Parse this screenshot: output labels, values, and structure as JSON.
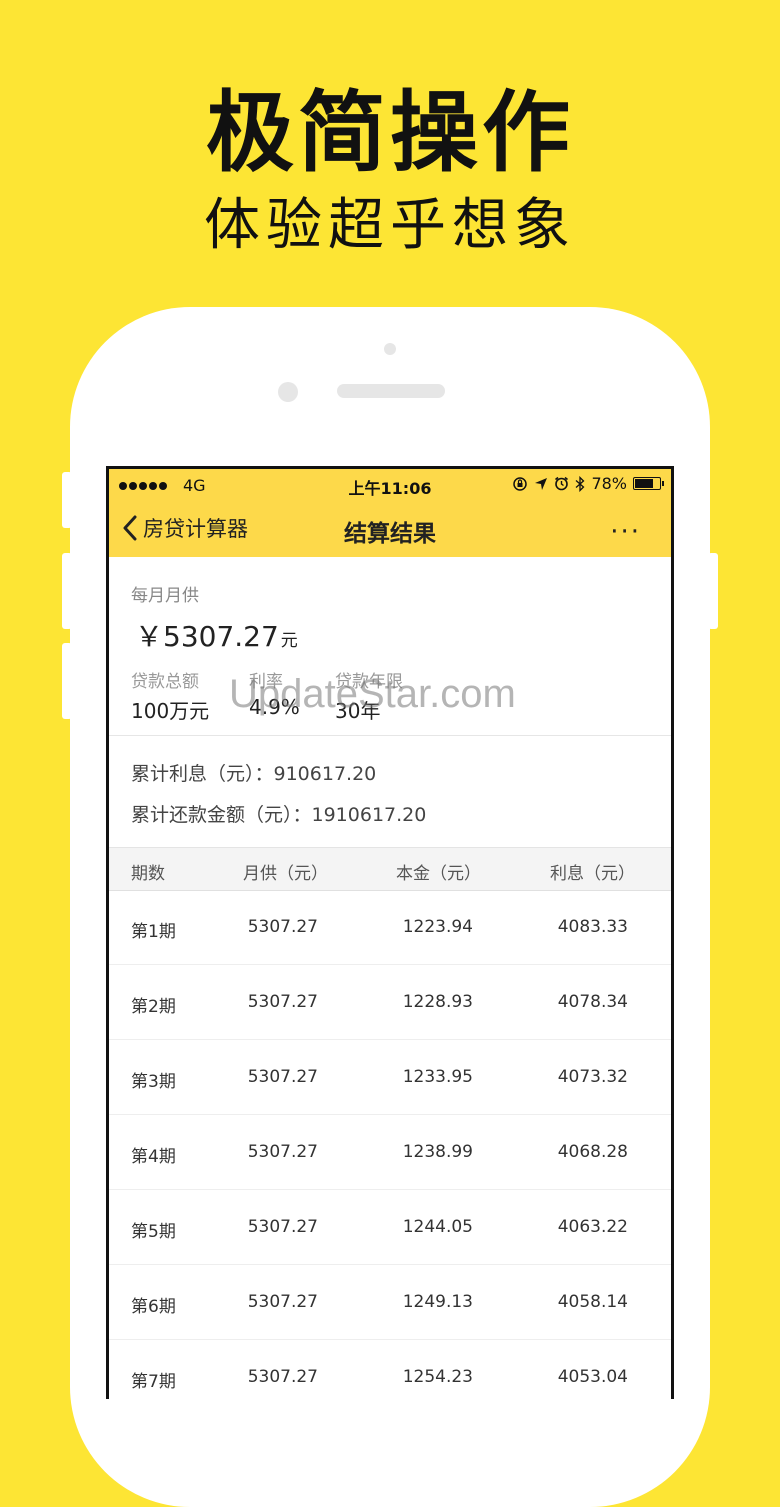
{
  "promo": {
    "headline": "极简操作",
    "subheadline": "体验超乎想象"
  },
  "statusbar": {
    "carrier": "4G",
    "time": "上午11:06",
    "battery": "78%",
    "battery_level": 0.78
  },
  "nav": {
    "back_label": "房贷计算器",
    "title": "结算结果",
    "more_label": "···"
  },
  "summary": {
    "monthly_label": "每月月供",
    "monthly_amount": "￥5307.27",
    "monthly_unit": "元",
    "total_loan_label": "贷款总额",
    "total_loan_value": "100万元",
    "rate_label": "利率",
    "rate_value": "4.9%",
    "term_label": "贷款年限",
    "term_value": "30年"
  },
  "watermark": "UpdateStar.com",
  "totals": {
    "interest": "累计利息（元）：910617.20",
    "repayment": "累计还款金额（元）：1910617.20"
  },
  "table": {
    "headers": [
      "期数",
      "月供（元）",
      "本金（元）",
      "利息（元）"
    ],
    "rows": [
      [
        "第1期",
        "5307.27",
        "1223.94",
        "4083.33"
      ],
      [
        "第2期",
        "5307.27",
        "1228.93",
        "4078.34"
      ],
      [
        "第3期",
        "5307.27",
        "1233.95",
        "4073.32"
      ],
      [
        "第4期",
        "5307.27",
        "1238.99",
        "4068.28"
      ],
      [
        "第5期",
        "5307.27",
        "1244.05",
        "4063.22"
      ],
      [
        "第6期",
        "5307.27",
        "1249.13",
        "4058.14"
      ],
      [
        "第7期",
        "5307.27",
        "1254.23",
        "4053.04"
      ]
    ]
  }
}
